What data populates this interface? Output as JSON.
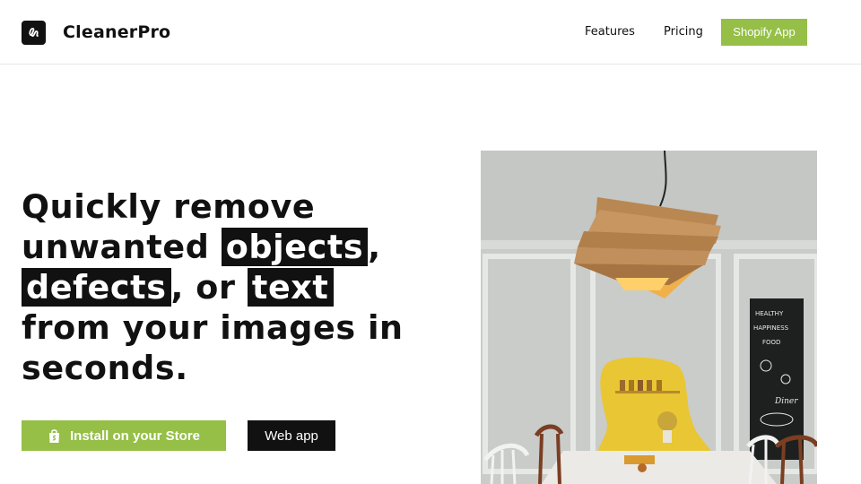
{
  "brand": {
    "name": "CleanerPro",
    "logo_icon": "scribble-logo-icon"
  },
  "nav": {
    "features": "Features",
    "pricing": "Pricing",
    "cta": "Shopify App"
  },
  "hero": {
    "line1": "Quickly remove",
    "line2_pre": "unwanted ",
    "line2_hl": "objects",
    "line2_post": ",",
    "line3_hl1": "defects",
    "line3_mid": ", or ",
    "line3_hl2": "text",
    "line4": "from your images in",
    "line5": "seconds.",
    "install_label": "Install on your Store",
    "webapp_label": "Web app"
  },
  "image": {
    "chalkboard_lines": [
      "HEALTHY",
      "HAPPINESS",
      "FOOD",
      "Diner"
    ]
  },
  "colors": {
    "accent_green": "#95bf47",
    "black": "#111111",
    "highlight_mask": "#f3c400"
  }
}
